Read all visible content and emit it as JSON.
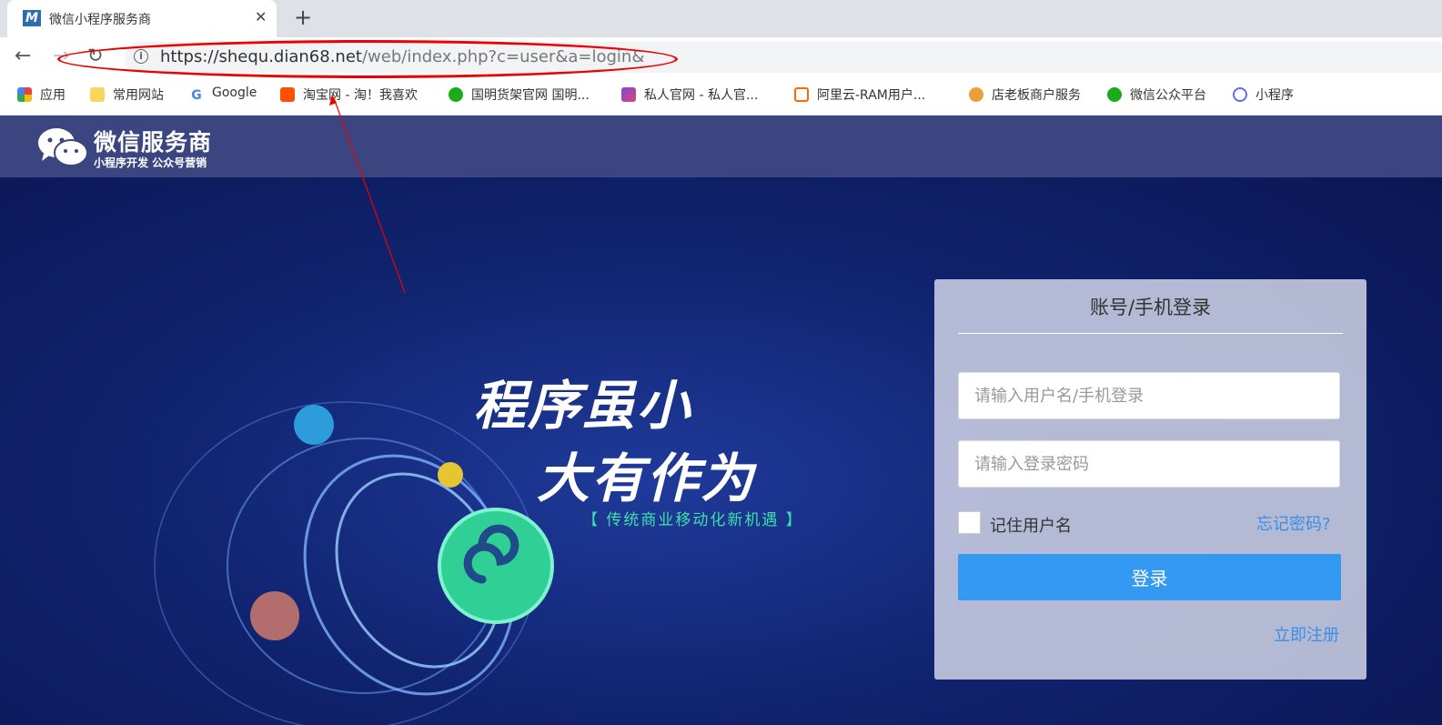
{
  "browser": {
    "tab": {
      "title": "微信小程序服务商",
      "favicon": "M"
    },
    "url": {
      "host": "https://shequ.dian68.net",
      "path": "/web/index.php?c=user&a=login&"
    },
    "bookmarks": [
      {
        "label": "应用",
        "icon": "apps-grid-icon"
      },
      {
        "label": "常用网站",
        "icon": "folder-icon"
      },
      {
        "label": "Google",
        "icon": "google-icon"
      },
      {
        "label": "淘宝网 - 淘！我喜欢",
        "icon": "taobao-icon"
      },
      {
        "label": "国明货架官网 国明...",
        "icon": "guoming-icon"
      },
      {
        "label": "私人官网 - 私人官...",
        "icon": "private-site-icon"
      },
      {
        "label": "阿里云-RAM用户...",
        "icon": "aliyun-icon"
      },
      {
        "label": "店老板商户服务",
        "icon": "shop-owner-icon"
      },
      {
        "label": "微信公众平台",
        "icon": "wechat-icon"
      },
      {
        "label": "小程序",
        "icon": "miniprogram-icon"
      }
    ]
  },
  "header": {
    "logo_title": "微信服务商",
    "logo_subtitle": "小程序开发  公众号营销"
  },
  "hero": {
    "line1": "程序虽小",
    "line2": "大有作为",
    "tagline": "【 传统商业移动化新机遇 】"
  },
  "login": {
    "title": "账号/手机登录",
    "username_placeholder": "请输入用户名/手机登录",
    "password_placeholder": "请输入登录密码",
    "remember_label": "记住用户名",
    "forgot_label": "忘记密码?",
    "submit_label": "登录",
    "register_label": "立即注册"
  },
  "colors": {
    "annotation": "#e00000",
    "primary_button": "#3399f3",
    "link": "#3a8ee6"
  }
}
